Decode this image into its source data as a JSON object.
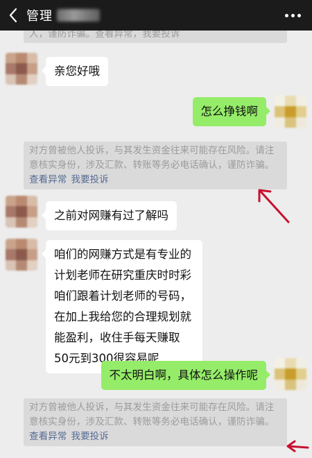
{
  "topbar": {
    "title": "管理",
    "icons": {
      "back": "chevron-left-icon",
      "more": "more-dots-icon"
    }
  },
  "notice": {
    "partial_top": "人，谨防诈骗。查看异常，我要投诉",
    "text": "对方曾被他人投诉，与其发生资金往来可能存在风险。请注意核实身份，涉及汇款、转账等务必电话确认，谨防诈骗。",
    "link_view": "查看异常",
    "link_report": "我要投诉"
  },
  "messages": [
    {
      "side": "left",
      "text": "亲您好哦"
    },
    {
      "side": "right",
      "text": "怎么挣钱啊"
    },
    {
      "side": "left",
      "text": "之前对网赚有过了解吗"
    },
    {
      "side": "left",
      "text": "咱们的网赚方式是有专业的计划老师在研究重庆时时彩 咱们跟着计划老师的号码，在加上我给您的合理规划就能盈利，收住手每天赚取50元到300很容易呢"
    },
    {
      "side": "right",
      "text": "不太明白啊，具体怎么操作呢"
    }
  ],
  "colors": {
    "topbar": "#1b1b1b",
    "background": "#ededed",
    "bubble_self": "#95ec69",
    "bubble_other": "#ffffff",
    "notice_bg": "#dadada",
    "notice_text": "#9c9c9c",
    "link": "#576b95",
    "annotation": "#c8102e"
  }
}
